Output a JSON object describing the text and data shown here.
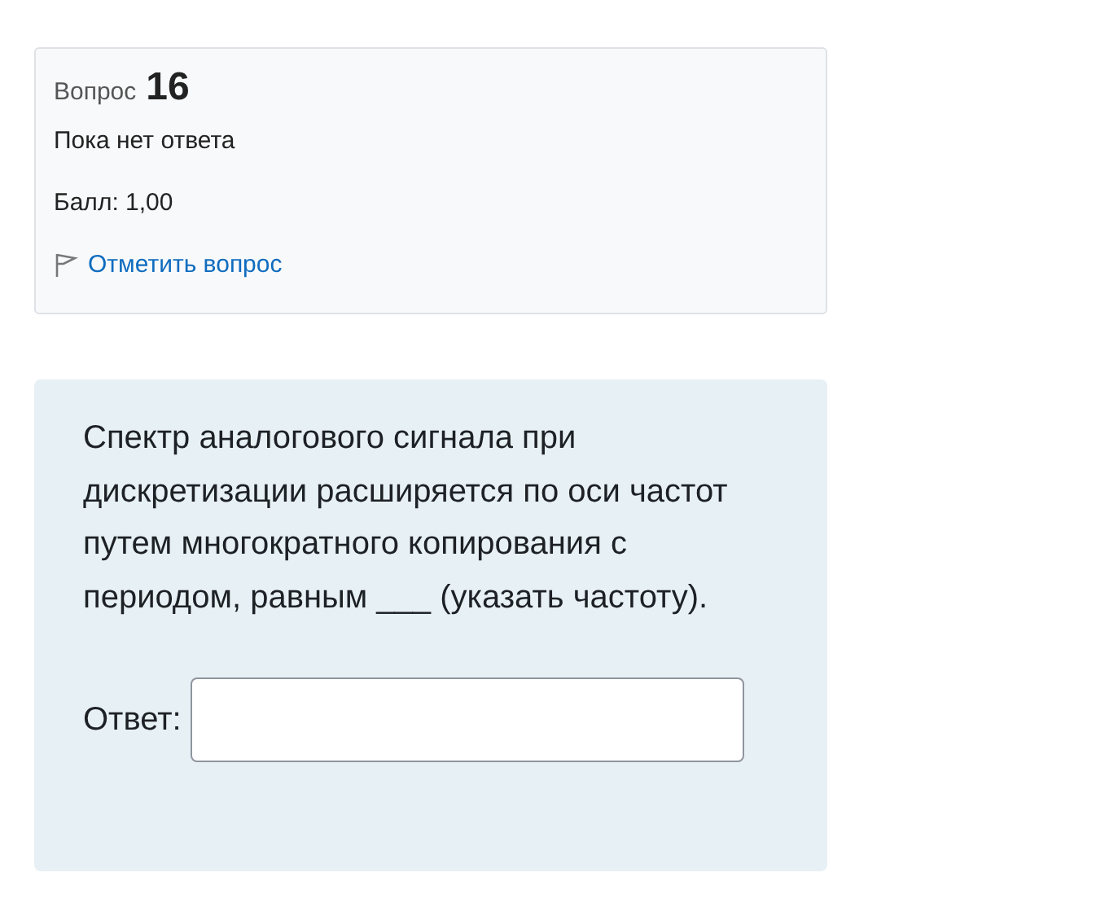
{
  "info": {
    "label": "Вопрос",
    "number": "16",
    "status": "Пока нет ответа",
    "grade": "Балл: 1,00",
    "flag_link": "Отметить вопрос"
  },
  "question": {
    "text": "Спектр аналогового сигнала при дискретизации расширяется по оси частот путем многократного копирования с периодом, равным ___ (указать частоту).",
    "answer_label": "Ответ:"
  }
}
